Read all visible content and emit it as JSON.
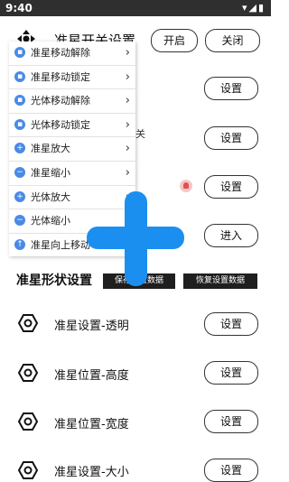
{
  "status_bar": {
    "time": "9:40"
  },
  "header": {
    "title": "准星开关设置",
    "open_label": "开启",
    "close_label": "关闭"
  },
  "menu": {
    "items": [
      {
        "icon": "lock-icon",
        "label": "准星移动解除"
      },
      {
        "icon": "lock-icon",
        "label": "准星移动锁定"
      },
      {
        "icon": "lock-icon",
        "label": "光体移动解除"
      },
      {
        "icon": "lock-icon",
        "label": "光体移动锁定"
      },
      {
        "icon": "plus-circle-icon",
        "label": "准星放大"
      },
      {
        "icon": "minus-circle-icon",
        "label": "准星缩小"
      },
      {
        "icon": "plus-circle-icon",
        "label": "光体放大"
      },
      {
        "icon": "minus-circle-icon",
        "label": "光体缩小"
      },
      {
        "icon": "arrow-up-circle-icon",
        "label": "准星向上移动"
      }
    ],
    "chevron": "›"
  },
  "side_char": "关",
  "right_buttons": {
    "settings_label": "设置",
    "enter_label": "进入"
  },
  "shape_section": {
    "title": "准星形状设置",
    "save_label": "保存设置数据",
    "restore_label": "恢复设置数据"
  },
  "rows": [
    {
      "label": "准星设置-透明",
      "button": "设置"
    },
    {
      "label": "准星位置-高度",
      "button": "设置"
    },
    {
      "label": "准星位置-宽度",
      "button": "设置"
    },
    {
      "label": "准星设置-大小",
      "button": "设置"
    }
  ]
}
